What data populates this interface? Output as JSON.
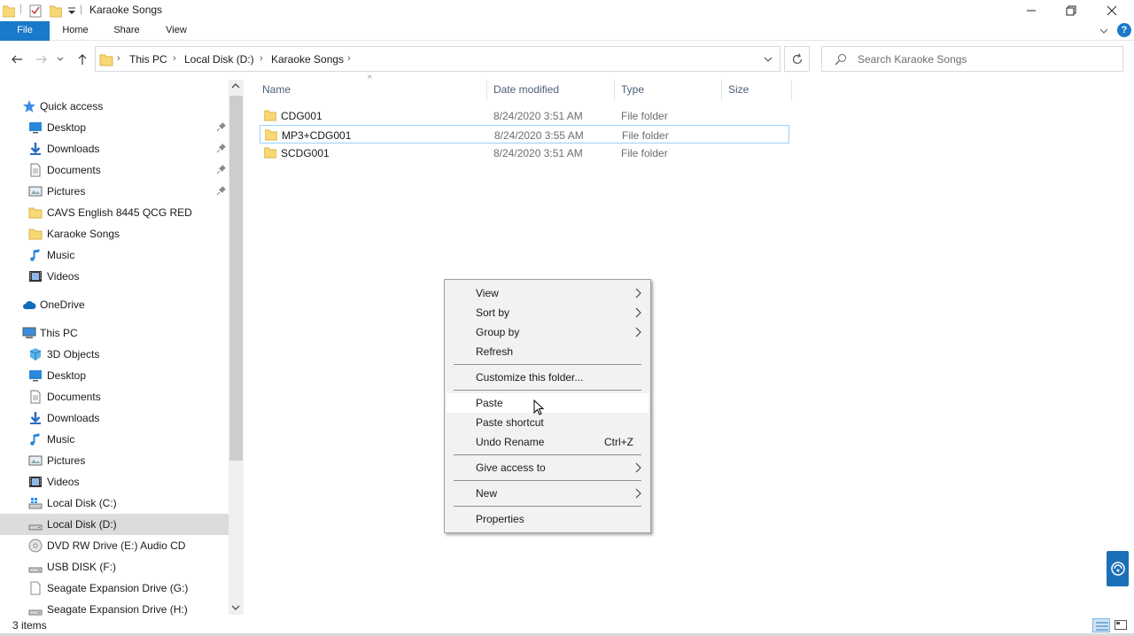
{
  "window": {
    "title": "Karaoke Songs",
    "quick_access_toolbar": [
      "folder-icon",
      "properties-icon",
      "new-folder-icon",
      "customize-dropdown-icon"
    ],
    "controls": [
      "minimize-icon",
      "restore-icon",
      "close-icon"
    ]
  },
  "ribbon": {
    "tabs": [
      "File",
      "Home",
      "Share",
      "View"
    ],
    "help_label": "?"
  },
  "address_bar": {
    "crumbs": [
      "This PC",
      "Local Disk (D:)",
      "Karaoke Songs"
    ],
    "search_placeholder": "Search Karaoke Songs"
  },
  "nav_pane": {
    "items": [
      {
        "label": "Quick access",
        "icon": "star-icon",
        "indent": 0
      },
      {
        "label": "Desktop",
        "icon": "desktop-icon",
        "indent": 1,
        "pinned": true
      },
      {
        "label": "Downloads",
        "icon": "download-icon",
        "indent": 1,
        "pinned": true
      },
      {
        "label": "Documents",
        "icon": "document-icon",
        "indent": 1,
        "pinned": true
      },
      {
        "label": "Pictures",
        "icon": "picture-icon",
        "indent": 1,
        "pinned": true
      },
      {
        "label": "CAVS English 8445 QCG RED",
        "icon": "folder-icon",
        "indent": 1
      },
      {
        "label": "Karaoke Songs",
        "icon": "folder-icon",
        "indent": 1
      },
      {
        "label": "Music",
        "icon": "music-icon",
        "indent": 1
      },
      {
        "label": "Videos",
        "icon": "video-icon",
        "indent": 1
      },
      {
        "label": "OneDrive",
        "icon": "cloud-icon",
        "indent": 0
      },
      {
        "label": "This PC",
        "icon": "computer-icon",
        "indent": 0
      },
      {
        "label": "3D Objects",
        "icon": "cube-icon",
        "indent": 1
      },
      {
        "label": "Desktop",
        "icon": "desktop-icon",
        "indent": 1
      },
      {
        "label": "Documents",
        "icon": "document-icon",
        "indent": 1
      },
      {
        "label": "Downloads",
        "icon": "download-icon",
        "indent": 1
      },
      {
        "label": "Music",
        "icon": "music-icon",
        "indent": 1
      },
      {
        "label": "Pictures",
        "icon": "picture-icon",
        "indent": 1
      },
      {
        "label": "Videos",
        "icon": "video-icon",
        "indent": 1
      },
      {
        "label": "Local Disk (C:)",
        "icon": "windows-drive-icon",
        "indent": 1
      },
      {
        "label": "Local Disk (D:)",
        "icon": "drive-icon",
        "indent": 1,
        "selected": true
      },
      {
        "label": "DVD RW Drive (E:) Audio CD",
        "icon": "disc-icon",
        "indent": 1
      },
      {
        "label": "USB DISK (F:)",
        "icon": "drive-icon",
        "indent": 1
      },
      {
        "label": "Seagate Expansion Drive (G:)",
        "icon": "blank-drive-icon",
        "indent": 1
      },
      {
        "label": "Seagate Expansion Drive (H:)",
        "icon": "drive-icon",
        "indent": 1
      }
    ]
  },
  "file_list": {
    "columns": [
      "Name",
      "Date modified",
      "Type",
      "Size"
    ],
    "sort_indicator": "^",
    "rows": [
      {
        "name": "CDG001",
        "date": "8/24/2020 3:51 AM",
        "type": "File folder",
        "size": ""
      },
      {
        "name": "MP3+CDG001",
        "date": "8/24/2020 3:55 AM",
        "type": "File folder",
        "size": "",
        "focused": true
      },
      {
        "name": "SCDG001",
        "date": "8/24/2020 3:51 AM",
        "type": "File folder",
        "size": ""
      }
    ]
  },
  "context_menu": {
    "items": [
      {
        "label": "View",
        "submenu": true
      },
      {
        "label": "Sort by",
        "submenu": true
      },
      {
        "label": "Group by",
        "submenu": true
      },
      {
        "label": "Refresh"
      },
      {
        "separator": true
      },
      {
        "label": "Customize this folder..."
      },
      {
        "separator": true
      },
      {
        "label": "Paste",
        "hover": true
      },
      {
        "label": "Paste shortcut"
      },
      {
        "label": "Undo Rename",
        "shortcut": "Ctrl+Z"
      },
      {
        "separator": true
      },
      {
        "label": "Give access to",
        "submenu": true
      },
      {
        "separator": true
      },
      {
        "label": "New",
        "submenu": true
      },
      {
        "separator": true
      },
      {
        "label": "Properties"
      }
    ]
  },
  "status_bar": {
    "item_count": "3 items"
  },
  "colors": {
    "accent": "#1979ca",
    "folder": "#f8d775",
    "selection": "#dcdcdc",
    "focus_border": "#99d1ff"
  }
}
